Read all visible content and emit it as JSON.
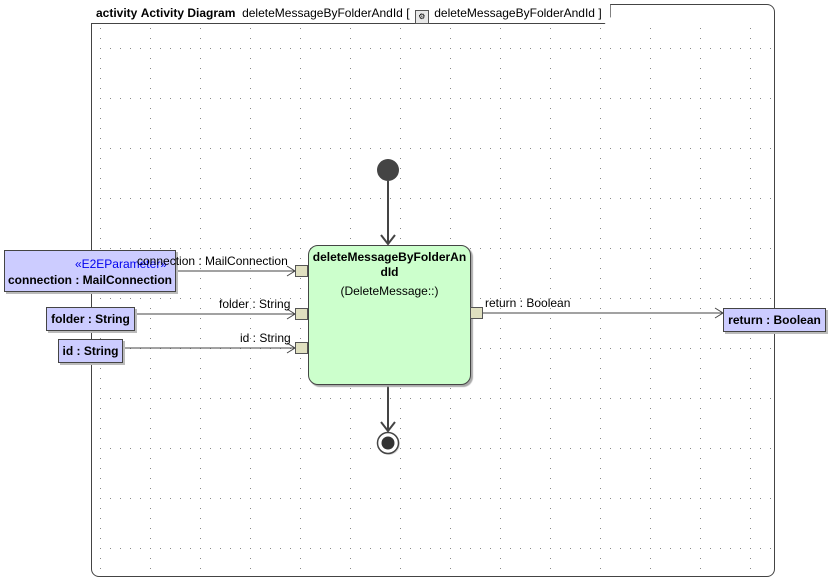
{
  "frame": {
    "kind": "activity",
    "type_label": "Activity Diagram",
    "name": "deleteMessageByFolderAndId",
    "bracket_open": "[",
    "ref_name": "deleteMessageByFolderAndId",
    "bracket_close": "]"
  },
  "action": {
    "name": "deleteMessageByFolderAndId",
    "behavior": "(DeleteMessage::)",
    "fill": "#ccffcc"
  },
  "parameters": [
    {
      "stereotype": "«E2EParameter»",
      "label": "connection : MailConnection",
      "pin_label": "connection : MailConnection"
    },
    {
      "label": "folder : String",
      "pin_label": "folder : String"
    },
    {
      "label": "id : String",
      "pin_label": "id : String"
    }
  ],
  "output": {
    "label": "return : Boolean",
    "pin_label": "return : Boolean"
  },
  "colors": {
    "parameter_fill": "#ccccff",
    "pin_fill": "#e0e0c0",
    "stereotype": "#0000ee"
  }
}
